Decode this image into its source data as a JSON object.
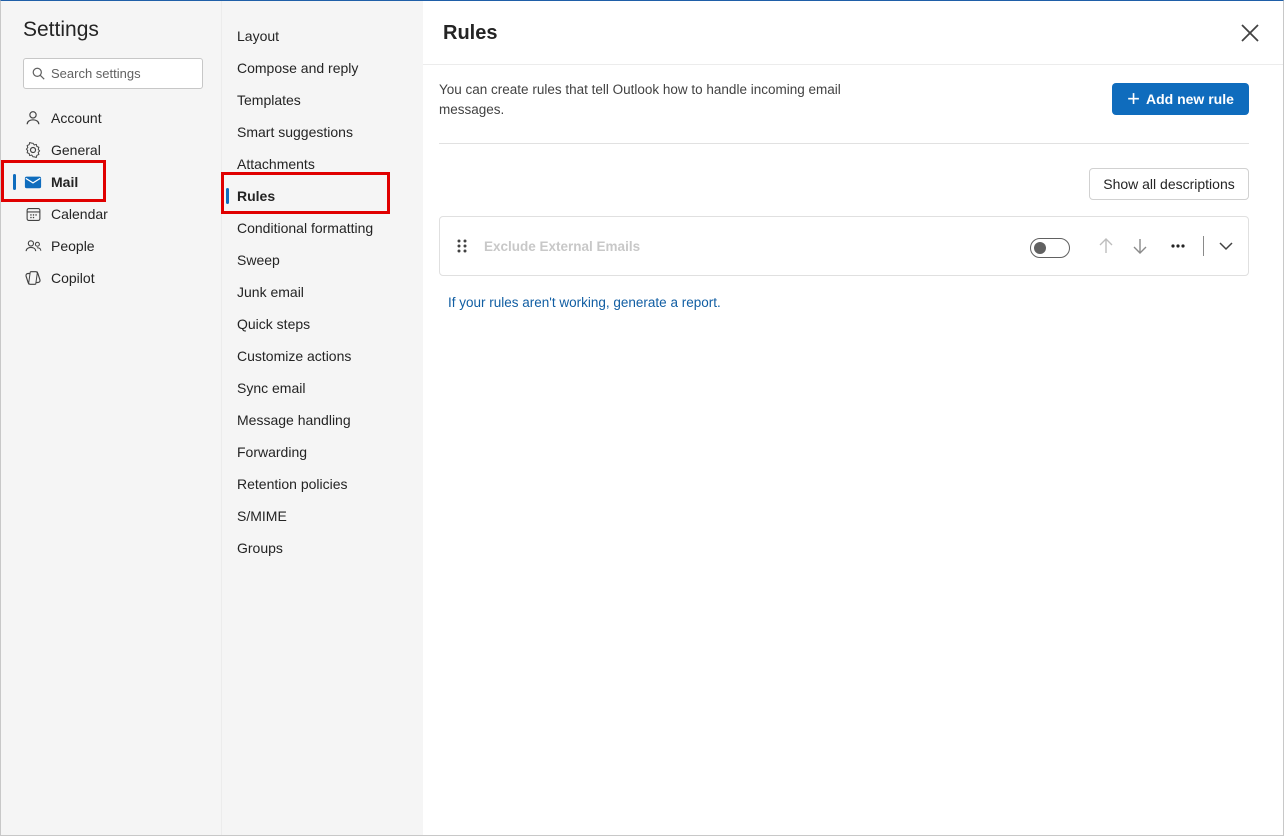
{
  "nav": {
    "title": "Settings",
    "search_placeholder": "Search settings",
    "items": [
      {
        "label": "Account",
        "icon": "person-icon"
      },
      {
        "label": "General",
        "icon": "gear-icon"
      },
      {
        "label": "Mail",
        "icon": "mail-icon"
      },
      {
        "label": "Calendar",
        "icon": "calendar-icon"
      },
      {
        "label": "People",
        "icon": "people-icon"
      },
      {
        "label": "Copilot",
        "icon": "copilot-icon"
      }
    ],
    "active": "Mail"
  },
  "subnav": {
    "items": [
      "Layout",
      "Compose and reply",
      "Templates",
      "Smart suggestions",
      "Attachments",
      "Rules",
      "Conditional formatting",
      "Sweep",
      "Junk email",
      "Quick steps",
      "Customize actions",
      "Sync email",
      "Message handling",
      "Forwarding",
      "Retention policies",
      "S/MIME",
      "Groups"
    ],
    "active": "Rules"
  },
  "main": {
    "title": "Rules",
    "description": "You can create rules that tell Outlook how to handle incoming email messages.",
    "add_button": "Add new rule",
    "show_button": "Show all descriptions",
    "rules": [
      {
        "name": "Exclude External Emails",
        "enabled": false
      }
    ],
    "report_link": "If your rules aren't working, generate a report."
  },
  "colors": {
    "accent": "#0f6cbd",
    "highlight": "#e00000",
    "link": "#115ea3"
  }
}
